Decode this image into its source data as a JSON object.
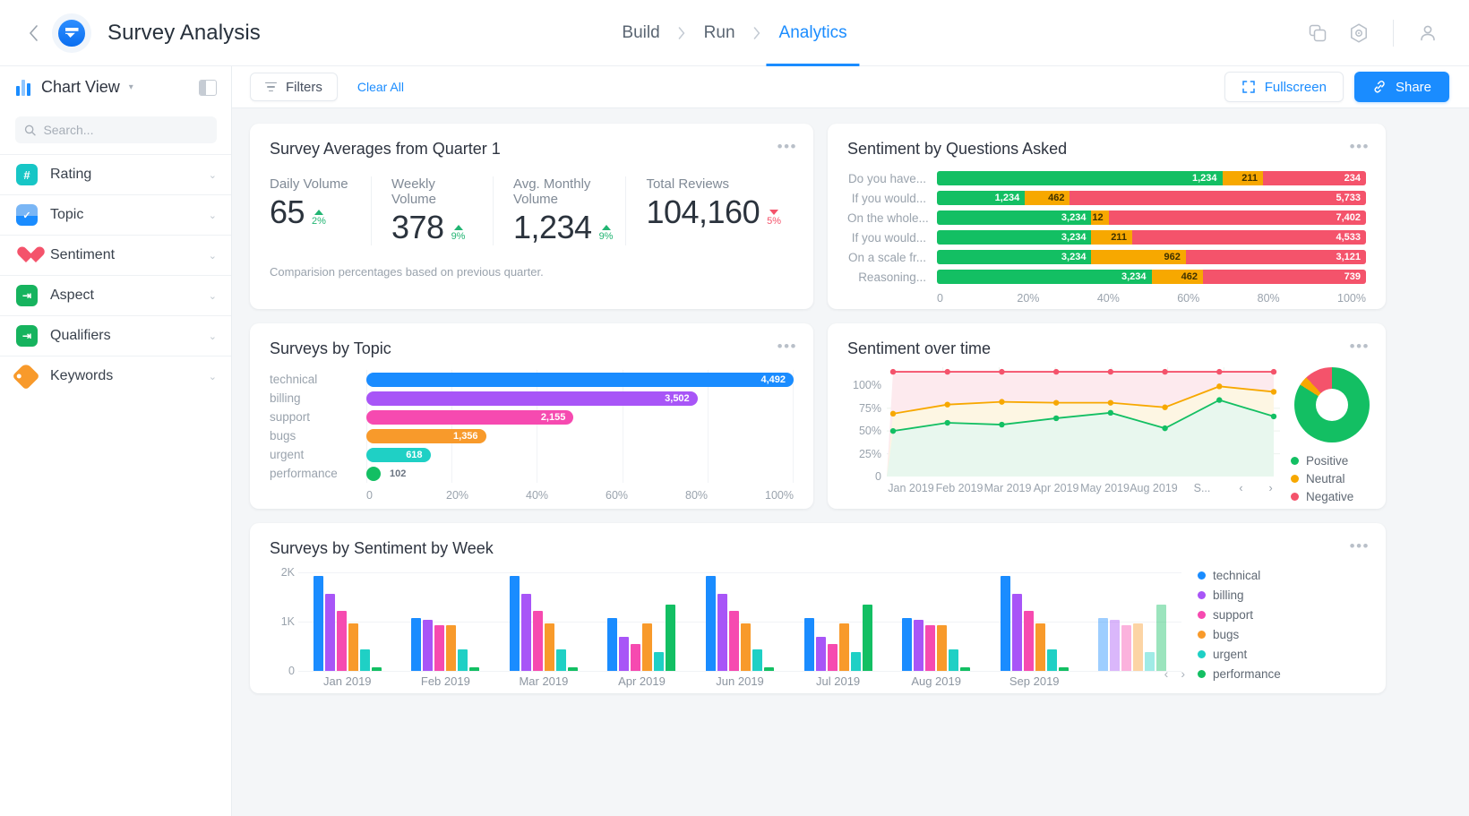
{
  "header": {
    "back_icon": "chevron-left-icon",
    "logo_icon": "app-logo-icon",
    "app_title": "Survey Analysis",
    "breadcrumb": [
      {
        "label": "Build",
        "active": false
      },
      {
        "label": "Run",
        "active": false
      },
      {
        "label": "Analytics",
        "active": true
      }
    ],
    "actions": [
      {
        "icon": "copy-icon"
      },
      {
        "icon": "settings-hex-icon"
      },
      {
        "icon": "user-account-icon"
      }
    ]
  },
  "sidebar": {
    "view_title": "Chart View",
    "view_caret_icon": "chevron-down-icon",
    "panel_toggle_icon": "panel-layout-icon",
    "search": {
      "placeholder": "Search...",
      "value": "",
      "icon": "search-icon"
    },
    "items": [
      {
        "label": "Rating",
        "icon": "hash-icon",
        "color": "#17c6c6",
        "glyph": "#"
      },
      {
        "label": "Topic",
        "icon": "checklist-icon",
        "color": "#1a8cff",
        "glyph": "✓"
      },
      {
        "label": "Sentiment",
        "icon": "heart-icon",
        "color": "#f4536b",
        "glyph": ""
      },
      {
        "label": "Aspect",
        "icon": "arrow-doc-icon",
        "color": "#16b35e",
        "glyph": "→"
      },
      {
        "label": "Qualifiers",
        "icon": "arrow-doc-icon",
        "color": "#16b35e",
        "glyph": "→"
      },
      {
        "label": "Keywords",
        "icon": "tag-icon",
        "color": "#f89a2b",
        "glyph": ""
      }
    ]
  },
  "toolbar": {
    "filters_label": "Filters",
    "filters_icon": "filter-icon",
    "clear_all_label": "Clear All",
    "fullscreen_label": "Fullscreen",
    "fullscreen_icon": "fullscreen-icon",
    "share_label": "Share",
    "share_icon": "link-icon",
    "menu_dots": "•••"
  },
  "cards": {
    "kpi": {
      "title": "Survey Averages from Quarter 1",
      "note": "Comparision percentages based on previous quarter.",
      "metrics": [
        {
          "label": "Daily Volume",
          "value": "65",
          "delta": "2%",
          "direction": "up"
        },
        {
          "label": "Weekly Volume",
          "value": "378",
          "delta": "9%",
          "direction": "up"
        },
        {
          "label": "Avg. Monthly Volume",
          "value": "1,234",
          "delta": "9%",
          "direction": "up"
        },
        {
          "label": "Total Reviews",
          "value": "104,160",
          "delta": "5%",
          "direction": "down"
        }
      ]
    },
    "sentiment_questions": {
      "title": "Sentiment by Questions Asked"
    },
    "topic": {
      "title": "Surveys by Topic"
    },
    "sentiment_time": {
      "title": "Sentiment over time"
    },
    "week": {
      "title": "Surveys by Sentiment by Week"
    }
  },
  "chart_data": [
    {
      "id": "sentiment_by_questions",
      "type": "bar",
      "orientation": "horizontal",
      "stacked": true,
      "title": "Sentiment by Questions Asked",
      "xlabel": "",
      "ylabel": "",
      "xticks": [
        "0",
        "20%",
        "40%",
        "60%",
        "80%",
        "100%"
      ],
      "xlim": [
        0,
        100
      ],
      "grid": false,
      "legend": [
        "Positive",
        "Neutral",
        "Negative"
      ],
      "colors": {
        "positive": "#13bf63",
        "neutral": "#f7a800",
        "negative": "#f4536b"
      },
      "categories": [
        "Do you have...",
        "If you would...",
        "On the whole...",
        "If you would...",
        "On a scale fr...",
        "Reasoning..."
      ],
      "series": [
        {
          "name": "Positive",
          "values": [
            1234,
            1234,
            3234,
            3234,
            3234,
            3234
          ]
        },
        {
          "name": "Neutral",
          "values": [
            211,
            462,
            12,
            211,
            962,
            462
          ]
        },
        {
          "name": "Negative",
          "values": [
            234,
            5733,
            7402,
            4533,
            3121,
            739
          ]
        }
      ],
      "bar_percent": [
        {
          "pos": 66.5,
          "neu": 9.5,
          "neg": 24.0
        },
        {
          "pos": 20.5,
          "neu": 10.5,
          "neg": 69.0
        },
        {
          "pos": 36.0,
          "neu": 4.0,
          "neg": 60.0
        },
        {
          "pos": 36.0,
          "neu": 9.5,
          "neg": 54.5
        },
        {
          "pos": 36.0,
          "neu": 22.0,
          "neg": 42.0
        },
        {
          "pos": 50.0,
          "neu": 12.0,
          "neg": 38.0
        }
      ]
    },
    {
      "id": "surveys_by_topic",
      "type": "bar",
      "orientation": "horizontal",
      "title": "Surveys by Topic",
      "xticks": [
        "0",
        "20%",
        "40%",
        "60%",
        "80%",
        "100%"
      ],
      "xlim": [
        0,
        100
      ],
      "grid": true,
      "categories": [
        "technical",
        "billing",
        "support",
        "bugs",
        "urgent",
        "performance"
      ],
      "values": [
        4492,
        3502,
        2155,
        1356,
        618,
        102
      ],
      "value_labels": [
        "4,492",
        "3,502",
        "2,155",
        "1,356",
        "618",
        "102"
      ],
      "percent": [
        100,
        77.5,
        48.5,
        28.0,
        15.0,
        3.0
      ],
      "colors": [
        "#1a8cff",
        "#a855f7",
        "#f64ab0",
        "#f89a2b",
        "#1fd0c5",
        "#13bf63"
      ]
    },
    {
      "id": "sentiment_over_time",
      "type": "line",
      "title": "Sentiment over time",
      "yticks": [
        "0",
        "25%",
        "50%",
        "75%",
        "100%"
      ],
      "ylim": [
        0,
        120
      ],
      "grid": true,
      "x": [
        "Jan 2019",
        "Feb 2019",
        "Mar 2019",
        "Apr 2019",
        "May 2019",
        "Aug 2019",
        "S..."
      ],
      "legend": [
        "Positive",
        "Neutral",
        "Negative"
      ],
      "legend_position": "right",
      "series": [
        {
          "name": "Positive",
          "color": "#13bf63",
          "values": [
            50,
            59,
            57,
            64,
            70,
            53,
            84,
            66
          ]
        },
        {
          "name": "Neutral",
          "color": "#f7a800",
          "values": [
            69,
            79,
            82,
            81,
            81,
            76,
            99,
            93
          ]
        },
        {
          "name": "Negative",
          "color": "#f4536b",
          "values": [
            115,
            115,
            115,
            115,
            115,
            115,
            115,
            115
          ]
        }
      ],
      "donut": [
        {
          "name": "Positive",
          "color": "#13bf63",
          "percent": 84
        },
        {
          "name": "Neutral",
          "color": "#f7a800",
          "percent": 4
        },
        {
          "name": "Negative",
          "color": "#f4536b",
          "percent": 12
        }
      ],
      "pager": {
        "prev_icon": "chevron-left-icon",
        "next_icon": "chevron-right-icon"
      }
    },
    {
      "id": "surveys_by_sentiment_by_week",
      "type": "bar",
      "orientation": "vertical",
      "grouped": true,
      "title": "Surveys by Sentiment by Week",
      "yticks": [
        "0",
        "1K",
        "2K"
      ],
      "ylim": [
        0,
        2000
      ],
      "grid": true,
      "categories": [
        "Jan 2019",
        "Feb 2019",
        "Mar 2019",
        "Apr 2019",
        "Jun 2019",
        "Jul 2019",
        "Aug 2019",
        "Sep 2019",
        ""
      ],
      "legend": [
        "technical",
        "billing",
        "support",
        "bugs",
        "urgent",
        "performance"
      ],
      "colors": {
        "technical": "#1a8cff",
        "billing": "#a855f7",
        "support": "#f64ab0",
        "bugs": "#f89a2b",
        "urgent": "#1fd0c5",
        "performance": "#13bf63"
      },
      "series": [
        {
          "name": "technical",
          "values": [
            1930,
            1070,
            1930,
            1070,
            1930,
            1070,
            1070,
            1930,
            1070
          ]
        },
        {
          "name": "billing",
          "values": [
            1560,
            1030,
            1560,
            700,
            1560,
            700,
            1030,
            1560,
            1030
          ]
        },
        {
          "name": "support",
          "values": [
            1230,
            930,
            1230,
            540,
            1230,
            540,
            930,
            1230,
            930
          ]
        },
        {
          "name": "bugs",
          "values": [
            960,
            930,
            960,
            960,
            960,
            960,
            930,
            960,
            960
          ]
        },
        {
          "name": "urgent",
          "values": [
            430,
            430,
            430,
            380,
            430,
            380,
            430,
            430,
            380
          ]
        },
        {
          "name": "performance",
          "values": [
            80,
            80,
            80,
            1350,
            80,
            1350,
            80,
            80,
            1350
          ]
        }
      ],
      "pager": {
        "prev_icon": "chevron-left-icon",
        "next_icon": "chevron-right-icon"
      }
    }
  ]
}
